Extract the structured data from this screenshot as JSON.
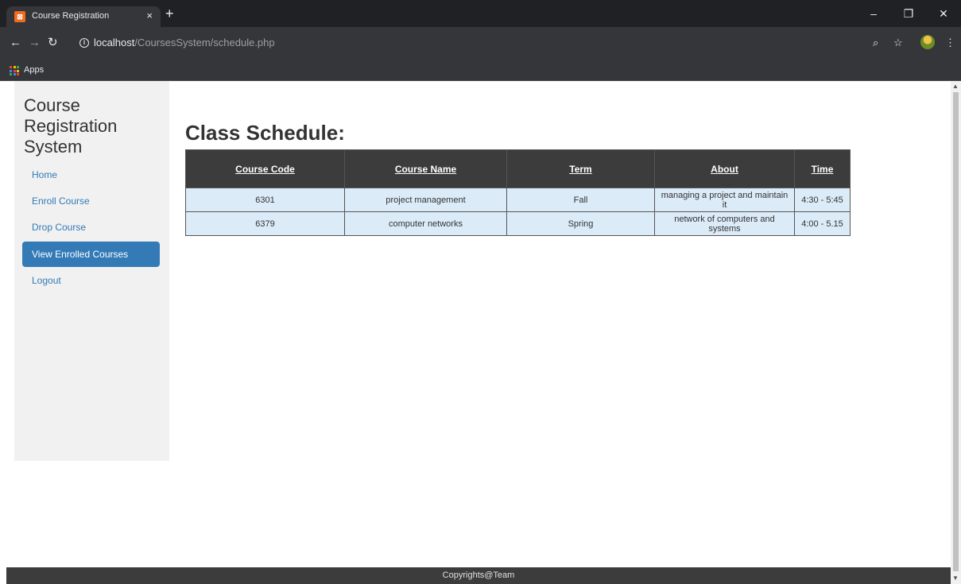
{
  "browser": {
    "tab_title": "Course Registration",
    "tab_close": "×",
    "new_tab": "+",
    "url_host": "localhost",
    "url_path": "/CoursesSystem/schedule.php",
    "bookmark_apps": "Apps",
    "window_controls": {
      "minimize": "–",
      "restore": "❐",
      "close": "✕"
    }
  },
  "sidebar": {
    "brand": "Course Registration System",
    "items": [
      {
        "label": "Home",
        "active": false
      },
      {
        "label": "Enroll Course",
        "active": false
      },
      {
        "label": "Drop Course",
        "active": false
      },
      {
        "label": "View Enrolled Courses",
        "active": true
      },
      {
        "label": "Logout",
        "active": false
      }
    ]
  },
  "main": {
    "title": "Class Schedule:",
    "table": {
      "headers": [
        "Course Code",
        "Course Name",
        "Term",
        "About",
        "Time"
      ],
      "rows": [
        [
          "6301",
          "project management",
          "Fall",
          "managing a project and maintain it",
          "4:30 - 5:45"
        ],
        [
          "6379",
          "computer networks",
          "Spring",
          "network of computers and systems",
          "4:00 - 5.15"
        ]
      ]
    }
  },
  "footer": {
    "text": "Copyrights@Team"
  },
  "colors": {
    "sidebar_bg": "#f1f1f1",
    "link": "#337ab7",
    "header_bg": "#3c3c3c",
    "row_bg": "#dcebf8"
  }
}
